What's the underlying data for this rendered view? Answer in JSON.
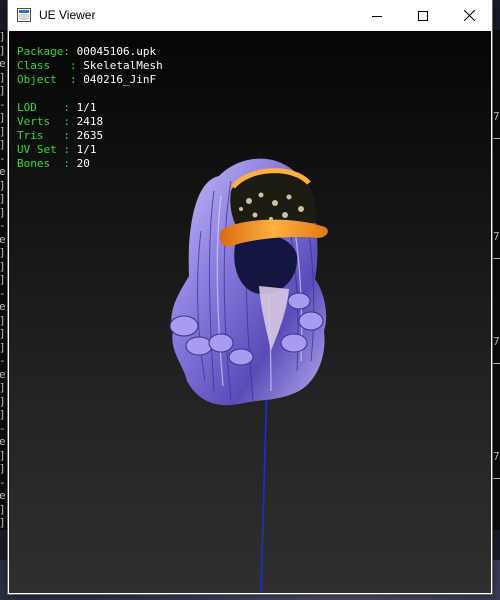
{
  "window": {
    "title": "UE Viewer",
    "controls": {
      "minimize": "minimize",
      "maximize": "maximize",
      "close": "close"
    }
  },
  "info": {
    "package_label": "Package",
    "package_value": "00045106.upk",
    "class_label": "Class",
    "class_value": "SkeletalMesh",
    "object_label": "Object",
    "object_value": "040216_JinF",
    "lod_label": "LOD",
    "lod_value": "1/1",
    "verts_label": "Verts",
    "verts_value": "2418",
    "tris_label": "Tris",
    "tris_value": "2635",
    "uvset_label": "UV Set",
    "uvset_value": "1/1",
    "bones_label": "Bones",
    "bones_value": "20"
  },
  "background_console": {
    "left_lines": [
      "]",
      "]",
      "e",
      "]",
      "]",
      "-",
      "]",
      "]",
      "]",
      "-",
      "e",
      "]",
      "]",
      "]",
      "-",
      "e",
      "]",
      "]",
      "]",
      "-",
      "e",
      "]",
      "]",
      "]",
      "-",
      "e",
      "]",
      "]",
      "]",
      "-",
      "e",
      "]",
      "]",
      "-",
      "e",
      "]",
      "]"
    ],
    "right_marks": [
      "7",
      "7",
      "7",
      "7"
    ]
  },
  "colors": {
    "info_key": "#33dd33",
    "info_value": "#ffffff",
    "hair": "#9a8ce6",
    "cap": "#f08a1c",
    "bone_line": "#1a2fd0"
  }
}
